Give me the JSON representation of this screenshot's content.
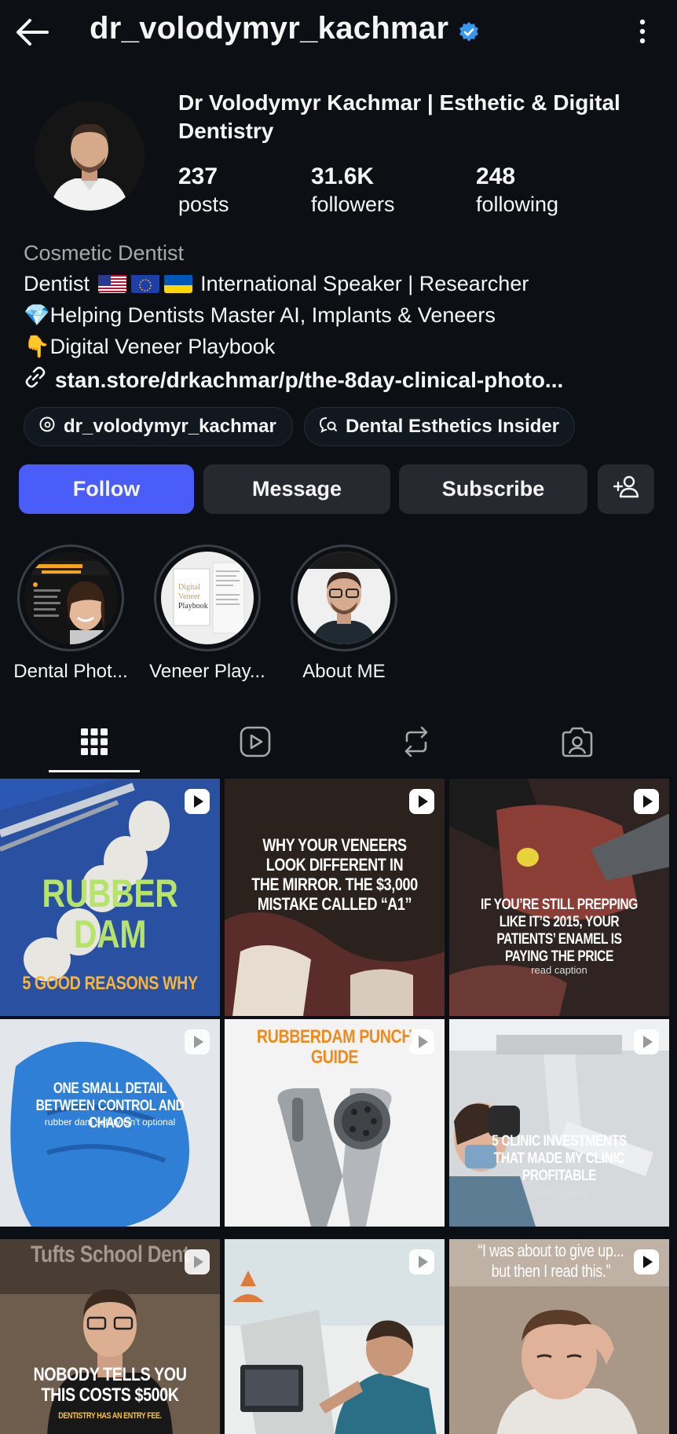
{
  "header": {
    "username": "dr_volodymyr_kachmar",
    "verified_icon": "verified-badge-icon",
    "back_icon": "back-arrow-icon",
    "more_icon": "more-vertical-icon"
  },
  "profile": {
    "full_name": "Dr Volodymyr Kachmar | Esthetic & Digital Dentistry",
    "stats": [
      {
        "value": "237",
        "label": "posts"
      },
      {
        "value": "31.6K",
        "label": "followers"
      },
      {
        "value": "248",
        "label": "following"
      }
    ],
    "category": "Cosmetic Dentist",
    "bio_line1_prefix": "Dentist",
    "bio_line1_suffix": "International Speaker | Researcher",
    "bio_line2": "💎Helping Dentists Master AI, Implants & Veneers",
    "bio_line3": "👇Digital Veneer Playbook",
    "link": "stan.store/drkachmar/p/the-8day-clinical-photo...",
    "chips": [
      {
        "label": "dr_volodymyr_kachmar",
        "icon": "threads-icon"
      },
      {
        "label": "Dental Esthetics Insider",
        "icon": "channel-icon"
      }
    ]
  },
  "actions": {
    "follow": "Follow",
    "message": "Message",
    "subscribe": "Subscribe",
    "add_user_icon": "add-user-icon"
  },
  "highlights": [
    {
      "label": "Dental Phot..."
    },
    {
      "label": "Veneer Play..."
    },
    {
      "label": "About ME"
    }
  ],
  "tabs": [
    {
      "name": "grid-icon",
      "active": true
    },
    {
      "name": "reels-icon",
      "active": false
    },
    {
      "name": "reposts-icon",
      "active": false
    },
    {
      "name": "tagged-icon",
      "active": false
    }
  ],
  "posts": [
    {
      "title": "RUBBER DAM",
      "subtitle": "5 GOOD REASONS WHY"
    },
    {
      "title": "WHY YOUR VENEERS LOOK DIFFERENT IN THE MIRROR. THE $3,000 MISTAKE CALLED “A1”"
    },
    {
      "title": "IF YOU’RE STILL PREPPING LIKE IT’S 2015, YOUR PATIENTS’ ENAMEL IS PAYING THE PRICE",
      "caption": "read caption"
    },
    {
      "title": "ONE SMALL DETAIL BETWEEN CONTROL AND CHAOS",
      "caption": "rubber dam safety isn't optional"
    },
    {
      "title": "RUBBERDAM PUNCH GUIDE"
    },
    {
      "title": "5 CLINIC INVESTMENTS THAT MADE MY CLINIC PROFITABLE",
      "caption": "read caption"
    },
    {
      "title": "NOBODY TELLS YOU THIS COSTS $500K",
      "caption": "DENTISTRY HAS AN ENTRY FEE.",
      "bg_text": "Tufts School Dent"
    },
    {
      "title": ""
    },
    {
      "title": "“I was about to give up... but then I read this.”"
    }
  ],
  "colors": {
    "background": "#0c1014",
    "follow_button": "#4a5df9",
    "secondary_button": "#262a30",
    "verified": "#3897f0",
    "muted_text": "#a8a8a8"
  }
}
